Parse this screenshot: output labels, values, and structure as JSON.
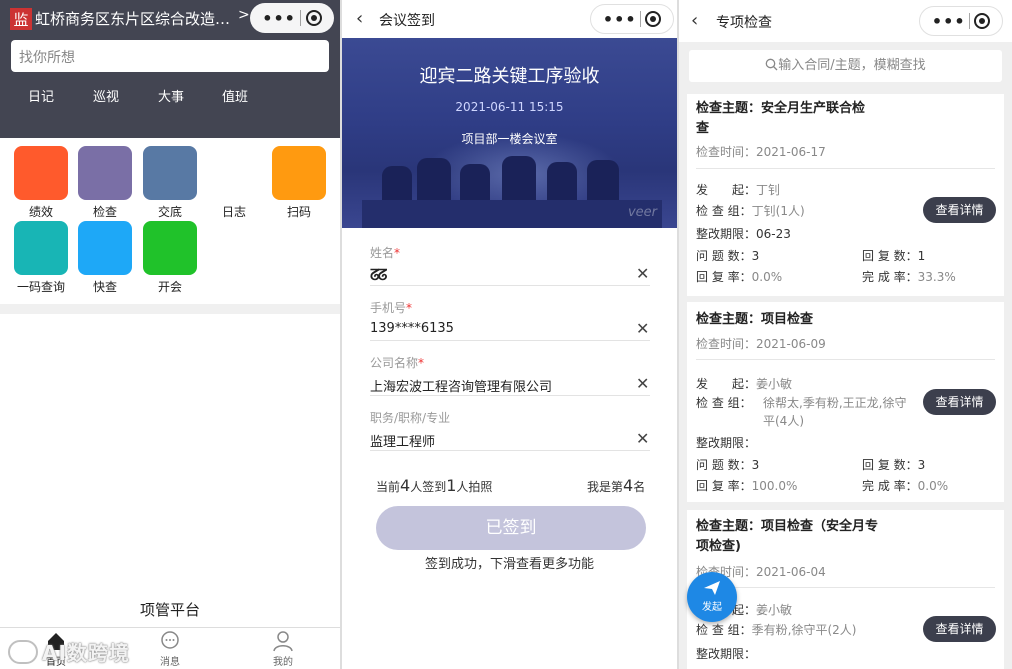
{
  "panel1": {
    "logo_char": "监",
    "title": "虹桥商务区东片区综合改造市…",
    "chevron": ">",
    "search_placeholder": "找你所想",
    "nav": [
      "日记",
      "巡视",
      "大事",
      "值班"
    ],
    "grid": [
      {
        "label": "绩效",
        "color": "#ff5a2c"
      },
      {
        "label": "检查",
        "color": "#7a6fa6"
      },
      {
        "label": "交底",
        "color": "#5879a4"
      },
      {
        "label": "日志",
        "color": ""
      },
      {
        "label": "扫码",
        "color": "#ff9a10"
      },
      {
        "label": "一码查询",
        "color": "#18b5b5"
      },
      {
        "label": "快查",
        "color": "#1ea8f7"
      },
      {
        "label": "开会",
        "color": "#20c22a"
      }
    ],
    "platform": "项管平台",
    "tabs": [
      "首页",
      "消息",
      "我的"
    ],
    "watermark": "AI数跨境"
  },
  "panel2": {
    "nav_title": "会议签到",
    "banner_title": "迎宾二路关键工序验收",
    "banner_date": "2021-06-11 15:15",
    "banner_room": "项目部一楼会议室",
    "banner_watermark": "veer",
    "fields": [
      {
        "label": "姓名",
        "required": "*",
        "value": "ᘔᘔ"
      },
      {
        "label": "手机号",
        "required": "*",
        "value": "139****6135"
      },
      {
        "label": "公司名称",
        "required": "*",
        "value": "上海宏波工程咨询管理有限公司"
      },
      {
        "label": "职务/职称/专业",
        "required": "",
        "value": "监理工程师"
      }
    ],
    "stat_pre": "当前",
    "stat_count": "4",
    "stat_mid": "人签到",
    "stat_photo": "1",
    "stat_post": "人拍照",
    "rank_pre": "我是第",
    "rank": "4",
    "rank_post": "名",
    "signed_label": "已签到",
    "signed_msg": "签到成功，下滑查看更多功能"
  },
  "panel3": {
    "nav_title": "专项检查",
    "search_placeholder": "输入合同/主题，模糊查找",
    "cards": [
      {
        "title": "检查主题：安全月生产联合检查",
        "time_label": "检查时间：",
        "time": "2021-06-17",
        "initiator_label": "发　　起：",
        "initiator": "丁钊",
        "group_label": "检 查 组：",
        "group": "丁钊(1人)",
        "deadline_label": "整改期限：",
        "deadline": "06-23",
        "issues_label": "问 题 数：",
        "issues": "3",
        "replies_label": "回 复 数：",
        "replies": "1",
        "reply_rate_label": "回 复 率：",
        "reply_rate": "0.0%",
        "complete_rate_label": "完 成 率：",
        "complete_rate": "33.3%",
        "button": "查看详情"
      },
      {
        "title": "检查主题：项目检查",
        "time_label": "检查时间：",
        "time": "2021-06-09",
        "initiator_label": "发　　起：",
        "initiator": "姜小敏",
        "group_label": "检 查 组：",
        "group": "徐帮太,季有粉,王正龙,徐守平(4人)",
        "deadline_label": "整改期限：",
        "deadline": "",
        "issues_label": "问 题 数：",
        "issues": "3",
        "replies_label": "回 复 数：",
        "replies": "3",
        "reply_rate_label": "回 复 率：",
        "reply_rate": "100.0%",
        "complete_rate_label": "完 成 率：",
        "complete_rate": "0.0%",
        "button": "查看详情"
      },
      {
        "title": "检查主题：项目检查（安全月专项检查)",
        "time_label": "检查时间：",
        "time": "2021-06-04",
        "initiator_label": "发　　起：",
        "initiator": "姜小敏",
        "group_label": "检 查 组：",
        "group": "季有粉,徐守平(2人)",
        "deadline_label": "整改期限：",
        "deadline": "",
        "button": "查看详情"
      }
    ],
    "fab_label": "发起"
  }
}
